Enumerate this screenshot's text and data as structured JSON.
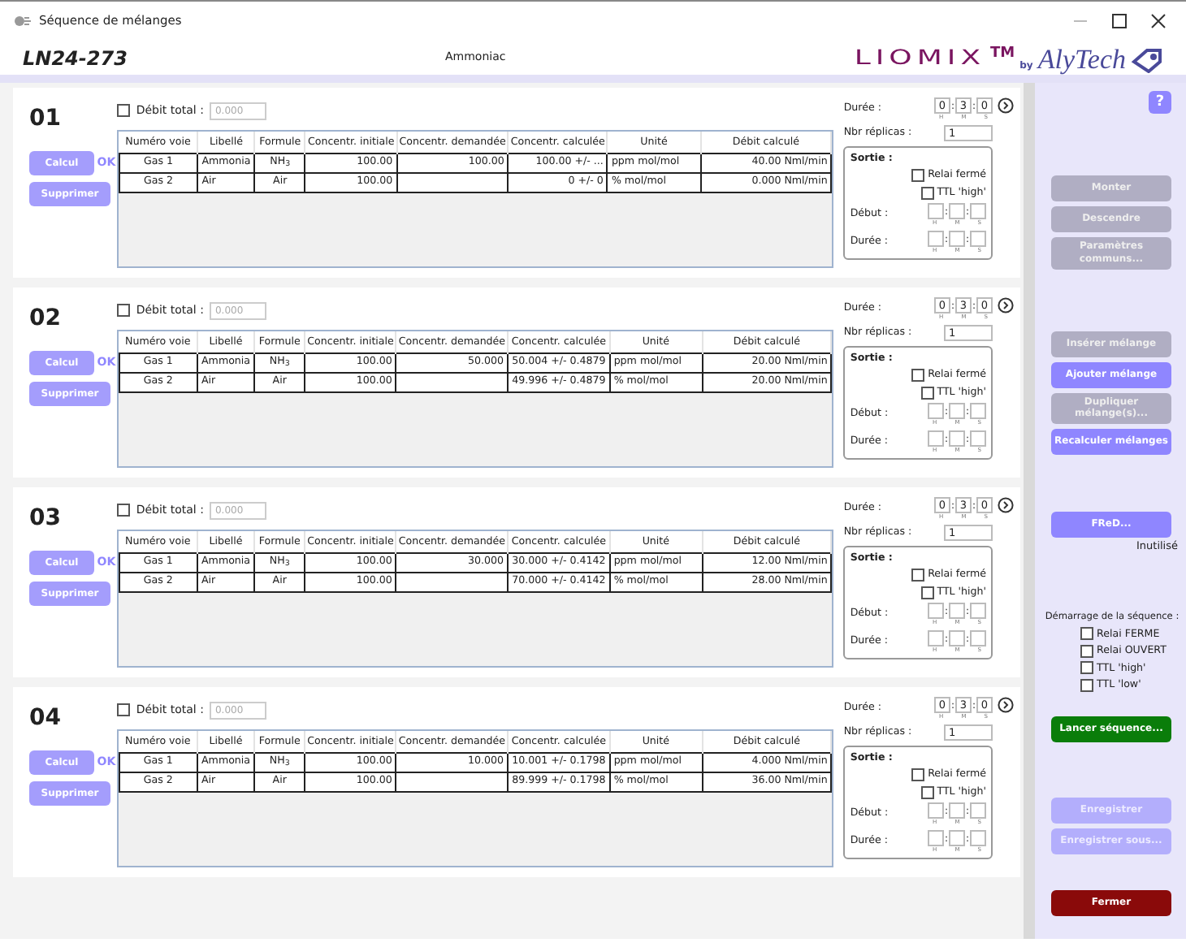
{
  "window": {
    "title": "Séquence de mélanges"
  },
  "header": {
    "code": "LN24-273",
    "gas": "Ammoniac",
    "logo": {
      "brand": "LIOMIX",
      "tm": "TM",
      "by": "by",
      "maker": "AlyTech"
    }
  },
  "mixtures": [
    {
      "number": "01",
      "total": {
        "label": "Débit total :",
        "checked": false,
        "placeholder": "0.000"
      },
      "calc": {
        "label": "Calcul",
        "status": "OK"
      },
      "delete": "Supprimer",
      "columns": [
        "Numéro voie",
        "Libellé",
        "Formule",
        "Concentr. initiale",
        "Concentr. demandée",
        "Concentr. calculée",
        "Unité",
        "Débit calculé"
      ],
      "rows": [
        [
          "Gas 1",
          "Ammonia",
          "NH$_{3}$",
          "100.00",
          "100.00",
          "100.00 +/- ...",
          "ppm mol/mol",
          "40.00 Nml/min"
        ],
        [
          "Gas 2",
          "Air",
          "Air",
          "100.00",
          null,
          "0 +/- 0",
          "% mol/mol",
          "0.000 Nml/min"
        ]
      ],
      "duration": {
        "label": "Durée :",
        "values": [
          "0",
          "3",
          "0"
        ],
        "sep": ":",
        "units": [
          "H",
          "M",
          "S"
        ]
      },
      "replicas": {
        "label": "Nbr réplicas :",
        "value": "1"
      },
      "output": {
        "title": "Sortie :",
        "options": [
          {
            "label": "Relai fermé",
            "checked": false
          },
          {
            "label": "TTL 'high'",
            "checked": false
          }
        ],
        "start": {
          "label": "Début :",
          "sep": ":",
          "units": [
            "H",
            "M",
            "S"
          ]
        },
        "duration": {
          "label": "Durée :",
          "sep": ":",
          "units": [
            "H",
            "M",
            "S"
          ]
        }
      }
    },
    {
      "number": "02",
      "total": {
        "label": "Débit total :",
        "checked": false,
        "placeholder": "0.000"
      },
      "calc": {
        "label": "Calcul",
        "status": "OK"
      },
      "delete": "Supprimer",
      "columns": [
        "Numéro voie",
        "Libellé",
        "Formule",
        "Concentr. initiale",
        "Concentr. demandée",
        "Concentr. calculée",
        "Unité",
        "Débit calculé"
      ],
      "rows": [
        [
          "Gas 1",
          "Ammonia",
          "NH$_{3}$",
          "100.00",
          "50.000",
          "50.004 +/- 0.4879",
          "ppm mol/mol",
          "20.00 Nml/min"
        ],
        [
          "Gas 2",
          "Air",
          "Air",
          "100.00",
          null,
          "49.996 +/- 0.4879",
          "% mol/mol",
          "20.00 Nml/min"
        ]
      ],
      "duration": {
        "label": "Durée :",
        "values": [
          "0",
          "3",
          "0"
        ],
        "sep": ":",
        "units": [
          "H",
          "M",
          "S"
        ]
      },
      "replicas": {
        "label": "Nbr réplicas :",
        "value": "1"
      },
      "output": {
        "title": "Sortie :",
        "options": [
          {
            "label": "Relai fermé",
            "checked": false
          },
          {
            "label": "TTL 'high'",
            "checked": false
          }
        ],
        "start": {
          "label": "Début :",
          "sep": ":",
          "units": [
            "H",
            "M",
            "S"
          ]
        },
        "duration": {
          "label": "Durée :",
          "sep": ":",
          "units": [
            "H",
            "M",
            "S"
          ]
        }
      }
    },
    {
      "number": "03",
      "total": {
        "label": "Débit total :",
        "checked": false,
        "placeholder": "0.000"
      },
      "calc": {
        "label": "Calcul",
        "status": "OK"
      },
      "delete": "Supprimer",
      "columns": [
        "Numéro voie",
        "Libellé",
        "Formule",
        "Concentr. initiale",
        "Concentr. demandée",
        "Concentr. calculée",
        "Unité",
        "Débit calculé"
      ],
      "rows": [
        [
          "Gas 1",
          "Ammonia",
          "NH$_{3}$",
          "100.00",
          "30.000",
          "30.000 +/- 0.4142",
          "ppm mol/mol",
          "12.00 Nml/min"
        ],
        [
          "Gas 2",
          "Air",
          "Air",
          "100.00",
          null,
          "70.000 +/- 0.4142",
          "% mol/mol",
          "28.00 Nml/min"
        ]
      ],
      "duration": {
        "label": "Durée :",
        "values": [
          "0",
          "3",
          "0"
        ],
        "sep": ":",
        "units": [
          "H",
          "M",
          "S"
        ]
      },
      "replicas": {
        "label": "Nbr réplicas :",
        "value": "1"
      },
      "output": {
        "title": "Sortie :",
        "options": [
          {
            "label": "Relai fermé",
            "checked": false
          },
          {
            "label": "TTL 'high'",
            "checked": false
          }
        ],
        "start": {
          "label": "Début :",
          "sep": ":",
          "units": [
            "H",
            "M",
            "S"
          ]
        },
        "duration": {
          "label": "Durée :",
          "sep": ":",
          "units": [
            "H",
            "M",
            "S"
          ]
        }
      }
    },
    {
      "number": "04",
      "total": {
        "label": "Débit total :",
        "checked": false,
        "placeholder": "0.000"
      },
      "calc": {
        "label": "Calcul",
        "status": "OK"
      },
      "delete": "Supprimer",
      "columns": [
        "Numéro voie",
        "Libellé",
        "Formule",
        "Concentr. initiale",
        "Concentr. demandée",
        "Concentr. calculée",
        "Unité",
        "Débit calculé"
      ],
      "rows": [
        [
          "Gas 1",
          "Ammonia",
          "NH$_{3}$",
          "100.00",
          "10.000",
          "10.001 +/- 0.1798",
          "ppm mol/mol",
          "4.000 Nml/min"
        ],
        [
          "Gas 2",
          "Air",
          "Air",
          "100.00",
          null,
          "89.999 +/- 0.1798",
          "% mol/mol",
          "36.00 Nml/min"
        ]
      ],
      "duration": {
        "label": "Durée :",
        "values": [
          "0",
          "3",
          "0"
        ],
        "sep": ":",
        "units": [
          "H",
          "M",
          "S"
        ]
      },
      "replicas": {
        "label": "Nbr réplicas :",
        "value": "1"
      },
      "output": {
        "title": "Sortie :",
        "options": [
          {
            "label": "Relai fermé",
            "checked": false
          },
          {
            "label": "TTL 'high'",
            "checked": false
          }
        ],
        "start": {
          "label": "Début :",
          "sep": ":",
          "units": [
            "H",
            "M",
            "S"
          ]
        },
        "duration": {
          "label": "Durée :",
          "sep": ":",
          "units": [
            "H",
            "M",
            "S"
          ]
        }
      }
    }
  ],
  "sidebar": {
    "help": "?",
    "groups": [
      [
        {
          "kind": "button",
          "label": "Monter",
          "disabled": true
        },
        {
          "kind": "button",
          "label": "Descendre",
          "disabled": true
        },
        {
          "kind": "button",
          "label": "Paramètres communs...",
          "disabled": true
        }
      ],
      [
        {
          "kind": "button",
          "label": "Insérer mélange",
          "disabled": true
        },
        {
          "kind": "button",
          "label": "Ajouter mélange",
          "disabled": false
        },
        {
          "kind": "button",
          "label": "Dupliquer mélange(s)...",
          "disabled": true
        },
        {
          "kind": "button",
          "label": "Recalculer mélanges",
          "disabled": false
        }
      ],
      [
        {
          "kind": "button",
          "label": "FReD...",
          "disabled": false
        },
        {
          "kind": "note",
          "label": "Inutilisé"
        }
      ],
      [
        {
          "kind": "heading",
          "label": "Démarrage de la séquence :"
        },
        {
          "kind": "checkbox",
          "label": "Relai FERME",
          "checked": false
        },
        {
          "kind": "checkbox",
          "label": "Relai OUVERT",
          "checked": false
        },
        {
          "kind": "checkbox",
          "label": "TTL 'high'",
          "checked": false
        },
        {
          "kind": "checkbox",
          "label": "TTL 'low'",
          "checked": false
        }
      ],
      [
        {
          "kind": "launch",
          "label": "Lancer séquence..."
        }
      ],
      [
        {
          "kind": "save",
          "label": "Enregistrer",
          "disabled": true
        },
        {
          "kind": "save",
          "label": "Enregistrer sous...",
          "disabled": true
        }
      ],
      [
        {
          "kind": "close",
          "label": "Fermer"
        }
      ]
    ]
  }
}
